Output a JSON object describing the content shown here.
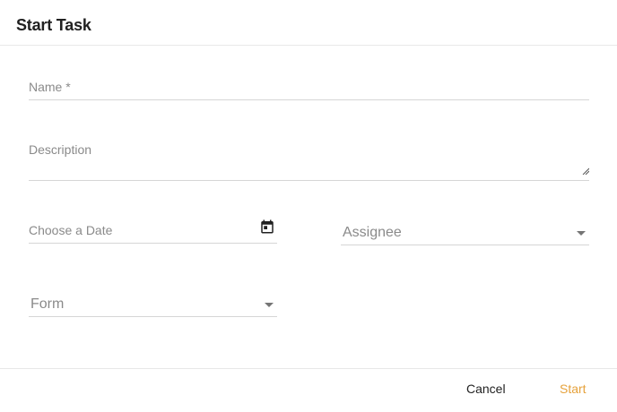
{
  "dialog": {
    "title": "Start Task"
  },
  "form": {
    "name_placeholder": "Name *",
    "description_placeholder": "Description",
    "date_placeholder": "Choose a Date",
    "assignee_placeholder": "Assignee",
    "form_placeholder": "Form"
  },
  "actions": {
    "cancel_label": "Cancel",
    "start_label": "Start"
  },
  "icons": {
    "date": "calendar-icon",
    "dropdown": "chevron-down-icon"
  },
  "colors": {
    "accent": "#e6a23c",
    "text": "#212121",
    "placeholder": "#8a8a8a",
    "divider": "#e8e8e8"
  }
}
